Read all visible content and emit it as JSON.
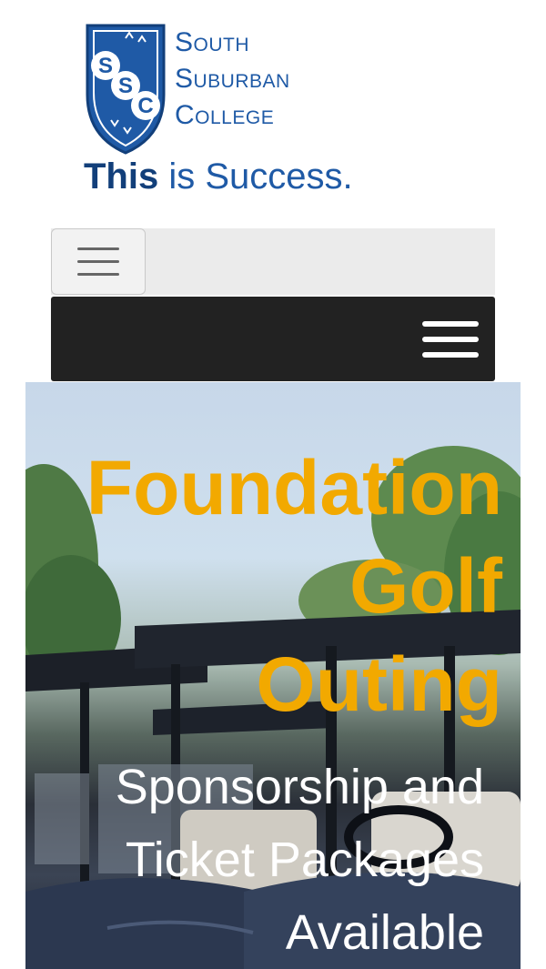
{
  "logo": {
    "monogram": [
      "S",
      "S",
      "C"
    ],
    "line1": "South",
    "line2": "Suburban",
    "line3": "College",
    "tagline_bold": "This",
    "tagline_rest": " is Success."
  },
  "hero": {
    "title_lines": [
      "Foundation",
      "Golf",
      "Outing"
    ],
    "subtitle_lines": [
      "Sponsorship and",
      "Ticket Packages",
      "Available"
    ]
  },
  "colors": {
    "brand_blue": "#1f5aa6",
    "accent_gold": "#f2a900",
    "nav_dark": "#222222"
  },
  "icons": {
    "toggler": "hamburger-icon",
    "menu": "hamburger-icon"
  }
}
